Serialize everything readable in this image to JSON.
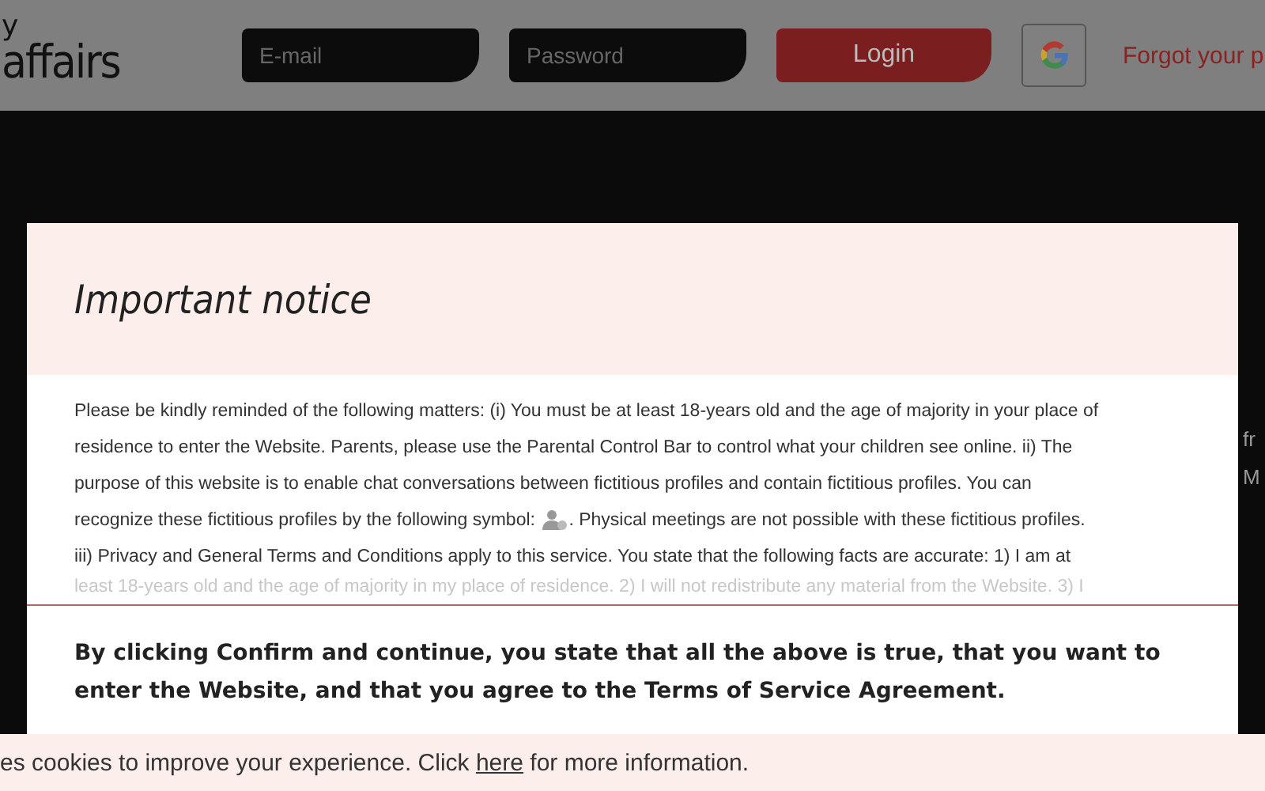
{
  "header": {
    "logo_top": "y",
    "logo": "affairs",
    "email": {
      "placeholder": "E-mail"
    },
    "password": {
      "placeholder": "Password"
    },
    "login_button": "Login",
    "forgot_link": "Forgot your p"
  },
  "background_fragments": [
    "fr",
    "M"
  ],
  "modal": {
    "title": "Important notice",
    "body_lines_before": [
      "Please be kindly reminded of the following matters: (i) You must be at least 18-years old and the age of majority in your place of",
      "residence to enter the Website. Parents, please use the Parental Control Bar to control what your children see online. ii) The",
      "purpose of this website is to enable chat conversations between fictitious profiles and contain fictitious profiles. You can"
    ],
    "symbol_line_before": "recognize these fictitious profiles by the following symbol:",
    "symbol_line_after": ". Physical meetings are not possible with these fictitious profiles.",
    "body_lines_after": [
      "iii) Privacy and General Terms and Conditions apply to this service. You state that the following facts are accurate: 1) I am at"
    ],
    "body_faded": "least 18-years old and the age of majority in my place of residence. 2) I will not redistribute any material from the Website. 3) I",
    "confirm_text": "By clicking Confirm and continue, you state that all the above is true, that you want to enter the Website, and that you agree to the Terms of Service Agreement."
  },
  "cookie_bar": {
    "before": "es cookies to improve your experience. Click",
    "link": "here",
    "after": "for more information."
  }
}
